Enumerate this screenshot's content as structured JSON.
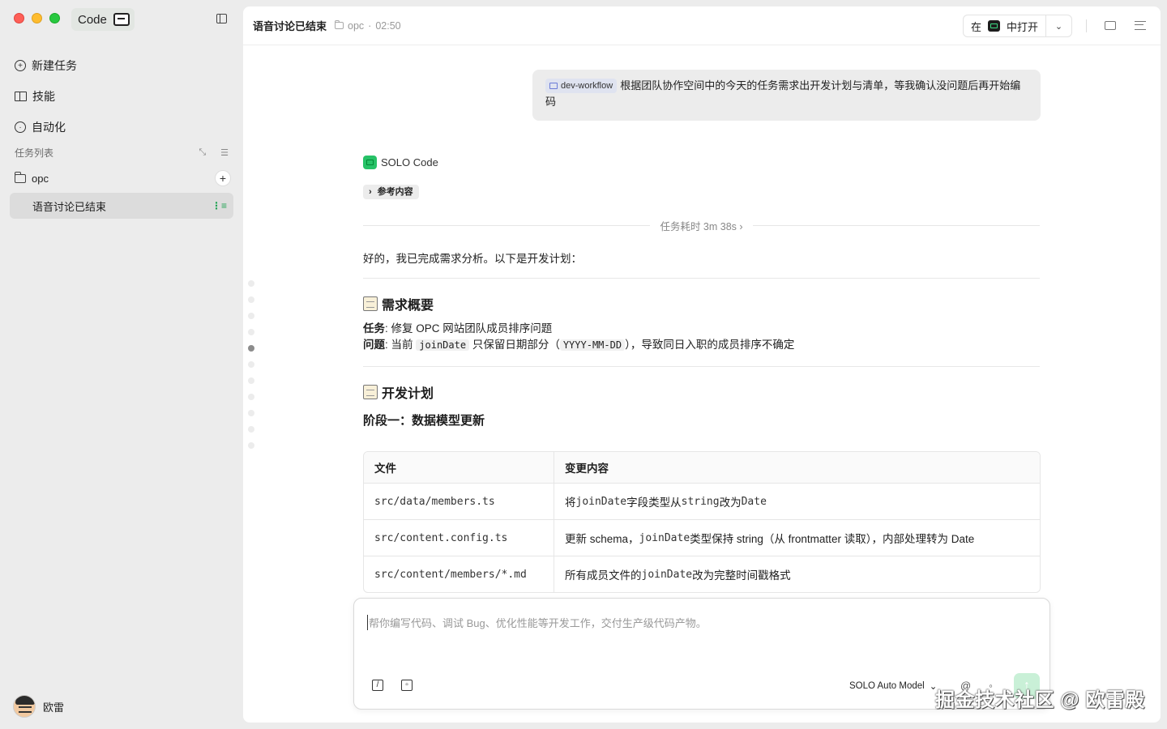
{
  "app": {
    "name": "Code"
  },
  "sidebar": {
    "nav": [
      {
        "label": "新建任务",
        "icon": "new-task-icon"
      },
      {
        "label": "技能",
        "icon": "book-icon"
      },
      {
        "label": "自动化",
        "icon": "clock-icon"
      }
    ],
    "tasks_header": "任务列表",
    "folder": "opc",
    "task": "语音讨论已结束",
    "user": "欧雷"
  },
  "header": {
    "title": "语音讨论已结束",
    "folder": "opc",
    "time": "02:50",
    "open_prefix": "在",
    "open_suffix": "中打开"
  },
  "conversation": {
    "user_chip": "dev-workflow",
    "user_message": "根据团队协作空间中的今天的任务需求出开发计划与清单，等我确认没问题后再开始编码",
    "bot_name": "SOLO Code",
    "ref_label": "参考内容",
    "duration": "任务耗时 3m 38s",
    "intro": "好的，我已完成需求分析。以下是开发计划：",
    "section1_title": "需求概要",
    "task_label": "任务",
    "task_text": ": 修复 OPC 网站团队成员排序问题",
    "issue_label": "问题",
    "issue_pre": ": 当前 ",
    "issue_code1": "joinDate",
    "issue_mid": " 只保留日期部分（",
    "issue_code2": "YYYY-MM-DD",
    "issue_post": "），导致同日入职的成员排序不确定",
    "section2_title": "开发计划",
    "phase1": "阶段一：数据模型更新",
    "table": {
      "headers": [
        "文件",
        "变更内容"
      ],
      "rows": [
        {
          "file": "src/data/members.ts",
          "pre": "将 ",
          "c1": "joinDate",
          "mid": " 字段类型从 ",
          "c2": "string",
          "mid2": " 改为 ",
          "c3": "Date",
          "post": ""
        },
        {
          "file": "src/content.config.ts",
          "pre": "更新 schema，",
          "c1": "joinDate",
          "mid": " 类型保持 string（从 frontmatter 读取），内部处理转为 Date",
          "c2": "",
          "mid2": "",
          "c3": "",
          "post": ""
        },
        {
          "file": "src/content/members/*.md",
          "pre": "所有成员文件的 ",
          "c1": "joinDate",
          "mid": " 改为完整时间戳格式",
          "c2": "",
          "mid2": "",
          "c3": "",
          "post": ""
        }
      ]
    }
  },
  "composer": {
    "placeholder": "帮你编写代码、调试 Bug、优化性能等开发工作，交付生产级代码产物。",
    "model": "SOLO Auto Model"
  },
  "watermark": "掘金技术社区 @ 欧雷殿"
}
